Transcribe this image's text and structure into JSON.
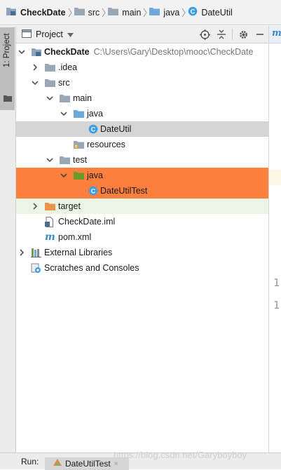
{
  "breadcrumb": [
    {
      "label": "CheckDate",
      "icon": "module-folder-icon"
    },
    {
      "label": "src",
      "icon": "folder-icon"
    },
    {
      "label": "main",
      "icon": "folder-icon"
    },
    {
      "label": "java",
      "icon": "source-folder-icon"
    },
    {
      "label": "DateUtil",
      "icon": "java-class-icon"
    }
  ],
  "tool_strip": {
    "project_tab_label": "1: Project"
  },
  "panel": {
    "title": "Project",
    "actions": [
      "locate-icon",
      "collapse-all-icon",
      "settings-gear-icon",
      "hide-minimize-icon"
    ]
  },
  "tree": {
    "root_name": "CheckDate",
    "root_path": "C:\\Users\\Gary\\Desktop\\mooc\\CheckDate",
    "idea": ".idea",
    "src": "src",
    "main": "main",
    "java_main": "java",
    "dateutil": "DateUtil",
    "resources": "resources",
    "test": "test",
    "java_test": "java",
    "dateutiltest": "DateUtilTest",
    "target": "target",
    "iml": "CheckDate.iml",
    "pom": "pom.xml",
    "external_libraries": "External Libraries",
    "scratches": "Scratches and Consoles"
  },
  "editor": {
    "tab_glyph": "m",
    "line_numbers": [
      "1",
      "1"
    ]
  },
  "runbar": {
    "label": "Run:",
    "tab_label": "DateUtilTest"
  },
  "watermark": "https://blog.csdn.net/Garyboyboy",
  "colors": {
    "selected_gray": "#d5d5d5",
    "selected_orange": "#ff7f3f",
    "excluded_green": "#ebf5e4",
    "folder_blue": "#6fa8dc",
    "test_folder_green": "#6a9a2a",
    "target_orange": "#e8944a"
  }
}
